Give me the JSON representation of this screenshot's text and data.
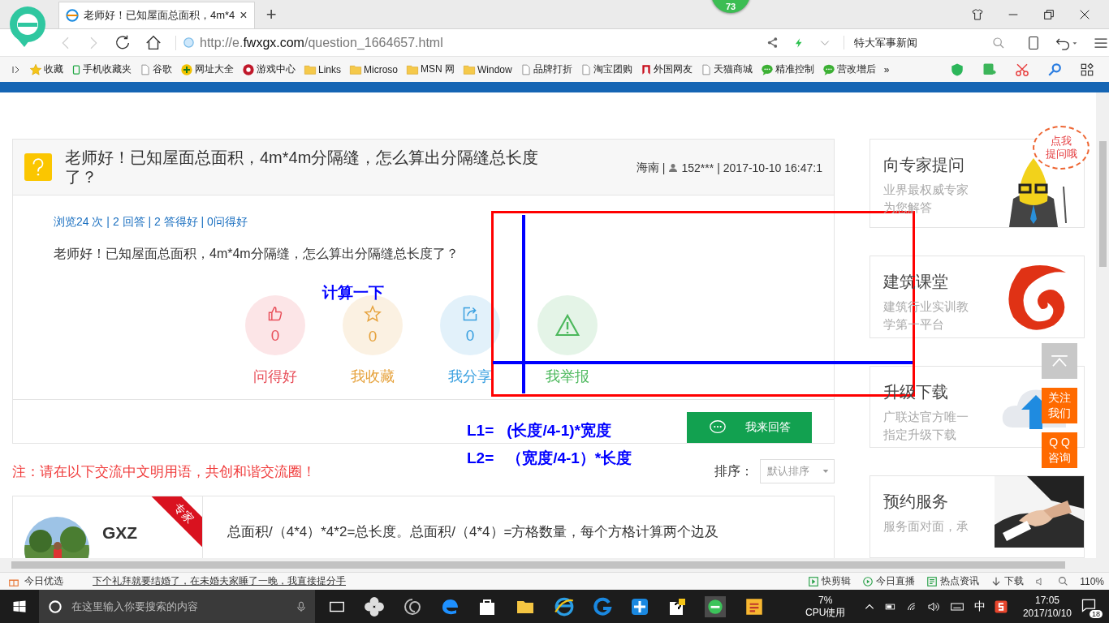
{
  "browser": {
    "tab": {
      "title": "老师好！已知屋面总面积，4m*4",
      "close": "×"
    },
    "new_tab": "+",
    "badge": "73",
    "url": {
      "prefix": "http://e.",
      "domain": "fwxgx.com",
      "path": "/question_1664657.html"
    },
    "search": {
      "value": "特大军事新闻"
    },
    "bookmarks": [
      {
        "label": "收藏",
        "kind": "star"
      },
      {
        "label": "手机收藏夹",
        "kind": "phone"
      },
      {
        "label": "谷歌",
        "kind": "page"
      },
      {
        "label": "网址大全",
        "kind": "plus"
      },
      {
        "label": "游戏中心",
        "kind": "game"
      },
      {
        "label": "Links",
        "kind": "folder"
      },
      {
        "label": "Microso",
        "kind": "folder"
      },
      {
        "label": "MSN 网",
        "kind": "folder"
      },
      {
        "label": "Window",
        "kind": "folder"
      },
      {
        "label": "品牌打折",
        "kind": "page"
      },
      {
        "label": "淘宝团购",
        "kind": "page"
      },
      {
        "label": "外国网友",
        "kind": "red"
      },
      {
        "label": "天猫商城",
        "kind": "page"
      },
      {
        "label": "精准控制",
        "kind": "chat"
      },
      {
        "label": "营改增后",
        "kind": "chat"
      }
    ],
    "more": "»"
  },
  "question": {
    "title": "老师好！已知屋面总面积，4m*4m分隔缝，怎么算出分隔缝总长度了？",
    "region": "海南",
    "user": "152***",
    "time": "2017-10-10 16:47:1",
    "separators": [
      "|",
      "|"
    ],
    "stats": "浏览24 次 | 2 回答 | 2 答得好 | 0问得好",
    "body": "老师好！已知屋面总面积，4m*4m分隔缝，怎么算出分隔缝总长度了？",
    "actions": [
      {
        "kind": "like",
        "count": "0",
        "label": "问得好",
        "color": "#e8505b"
      },
      {
        "kind": "star",
        "count": "0",
        "label": "我收藏",
        "color": "#e6a23c"
      },
      {
        "kind": "share",
        "count": "0",
        "label": "我分享",
        "color": "#3aa0e0"
      },
      {
        "kind": "report",
        "label": "我举报",
        "color": "#4cb85c"
      }
    ],
    "answer_button": "我来回答"
  },
  "notice": "注：请在以下交流中文明用语，共创和谐交流圈！",
  "sort": {
    "label": "排序：",
    "value": "默认排序"
  },
  "answer": {
    "user": "GXZ",
    "badge": "专家",
    "text": "总面积/（4*4）*4*2=总长度。总面积/（4*4）=方格数量，每个方格计算两个边及"
  },
  "sidebar": [
    {
      "kind": "expert",
      "title": "向专家提问",
      "desc": "业界最权威专家为您解答",
      "bubble": [
        "点我",
        "提问哦"
      ]
    },
    {
      "kind": "logo",
      "title": "建筑课堂",
      "desc": "建筑行业实训教学第一平台"
    },
    {
      "kind": "cloud",
      "title": "升级下载",
      "desc": "广联达官方唯一指定升级下载"
    },
    {
      "kind": "picture",
      "title": "预约服务",
      "desc": "服务面对面，承"
    }
  ],
  "floating": [
    {
      "kind": "top"
    },
    {
      "kind": "text",
      "lines": [
        "关注",
        "我们"
      ]
    },
    {
      "kind": "text",
      "lines": [
        "Q Q",
        "咨询"
      ]
    }
  ],
  "annotation": {
    "heading": "计算一下",
    "formulas": [
      {
        "lhs": "L1=",
        "rhs": "(长度/4-1)*宽度"
      },
      {
        "lhs": "L2=",
        "rhs": "（宽度/4-1）*长度"
      }
    ]
  },
  "status_bar": {
    "promo": "今日优选",
    "news": "下个礼拜就要结婚了，在未婚夫家睡了一晚，我直接提分手",
    "items": [
      {
        "kind": "clip",
        "label": "快剪辑"
      },
      {
        "kind": "live",
        "label": "今日直播"
      },
      {
        "kind": "news",
        "label": "热点资讯"
      },
      {
        "kind": "download",
        "label": "下载"
      }
    ],
    "zoom": "110%"
  },
  "taskbar": {
    "search_placeholder": "在这里输入你要搜索的内容",
    "cpu": "7%",
    "cpu_label": "CPU使用",
    "ime": "中",
    "time": "17:05",
    "date": "2017/10/10",
    "notifications": "18"
  }
}
